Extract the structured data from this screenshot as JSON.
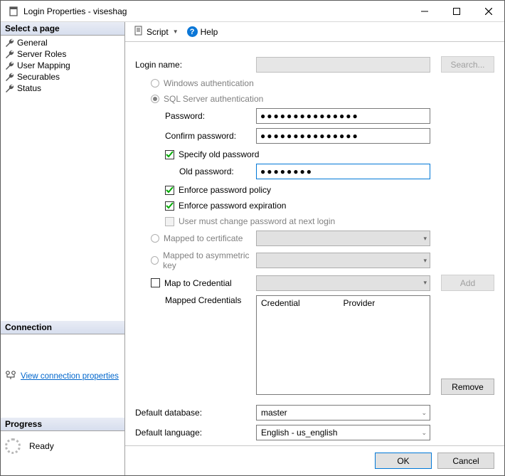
{
  "titlebar": {
    "title": "Login Properties - viseshag"
  },
  "sidebar": {
    "select_header": "Select a page",
    "items": [
      {
        "label": "General"
      },
      {
        "label": "Server Roles"
      },
      {
        "label": "User Mapping"
      },
      {
        "label": "Securables"
      },
      {
        "label": "Status"
      }
    ],
    "connection_header": "Connection",
    "connection_link": "View connection properties",
    "progress_header": "Progress",
    "progress_status": "Ready"
  },
  "toolbar": {
    "script": "Script",
    "help": "Help"
  },
  "form": {
    "login_name_label": "Login name:",
    "login_name_value": "",
    "search_btn": "Search...",
    "windows_auth": "Windows authentication",
    "sql_auth": "SQL Server authentication",
    "password_label": "Password:",
    "password_value": "●●●●●●●●●●●●●●●",
    "confirm_label": "Confirm password:",
    "confirm_value": "●●●●●●●●●●●●●●●",
    "specify_old": "Specify old password",
    "old_pwd_label": "Old password:",
    "old_pwd_value": "●●●●●●●●",
    "enforce_policy": "Enforce password policy",
    "enforce_expiration": "Enforce password expiration",
    "must_change": "User must change password at next login",
    "mapped_cert": "Mapped to certificate",
    "mapped_asym": "Mapped to asymmetric key",
    "map_cred": "Map to Credential",
    "add_btn": "Add",
    "mapped_credentials_label": "Mapped Credentials",
    "col_credential": "Credential",
    "col_provider": "Provider",
    "remove_btn": "Remove",
    "default_db_label": "Default database:",
    "default_db_value": "master",
    "default_lang_label": "Default language:",
    "default_lang_value": "English - us_english"
  },
  "footer": {
    "ok": "OK",
    "cancel": "Cancel"
  }
}
